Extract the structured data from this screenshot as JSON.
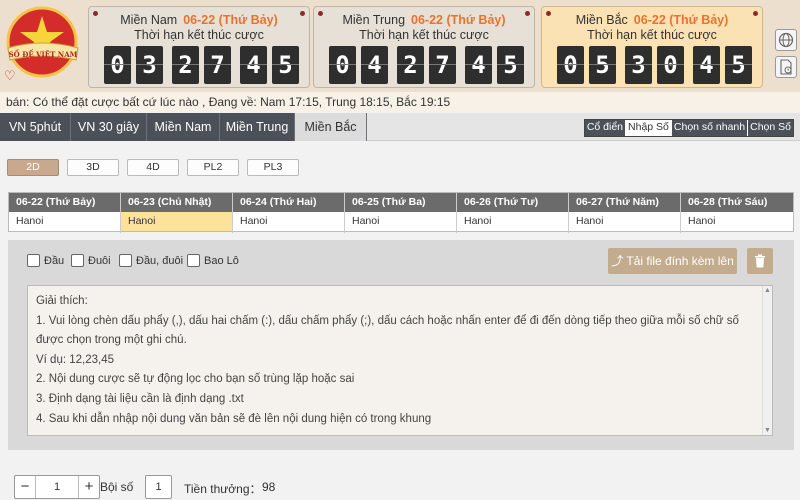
{
  "logo": {
    "text": "SỐ ĐỀ VIỆT NAM"
  },
  "regions": [
    {
      "name": "Miền Nam",
      "date": "06-22 (Thứ Bảy)",
      "subtitle": "Thời hạn kết thúc cược",
      "digits": [
        "0",
        "3",
        "2",
        "7",
        "4",
        "5"
      ],
      "active": false
    },
    {
      "name": "Miền Trung",
      "date": "06-22 (Thứ Bảy)",
      "subtitle": "Thời hạn kết thúc cược",
      "digits": [
        "0",
        "4",
        "2",
        "7",
        "4",
        "5"
      ],
      "active": false
    },
    {
      "name": "Miền Bắc",
      "date": "06-22 (Thứ Bảy)",
      "subtitle": "Thời hạn kết thúc cược",
      "digits": [
        "0",
        "5",
        "3",
        "0",
        "4",
        "5"
      ],
      "active": true
    }
  ],
  "side_icons": [
    "globe-icon",
    "document-clock-icon"
  ],
  "notice": "bán: Có thể đặt cược bất cứ lúc nào ,   Đang về: Nam 17:15, Trung 18:15, Bắc 19:15",
  "nav": {
    "tabs": [
      "VN 5phút",
      "VN 30 giây",
      "Miền Nam",
      "Miền Trung",
      "Miền Bắc"
    ],
    "active_tab": "Miền Bắc",
    "modes": [
      "Cổ điển",
      "Nhập Số",
      "Chọn số nhanh",
      "Chọn Số"
    ],
    "active_mode": "Nhập Số"
  },
  "game_types": [
    "2D",
    "3D",
    "4D",
    "PL2",
    "PL3"
  ],
  "active_game_type": "2D",
  "dates": [
    {
      "date": "06-22 (Thứ Bảy)",
      "place": "Hanoi"
    },
    {
      "date": "06-23 (Chủ Nhật)",
      "place": "Hanoi"
    },
    {
      "date": "06-24 (Thứ Hai)",
      "place": "Hanoi"
    },
    {
      "date": "06-25 (Thứ Ba)",
      "place": "Hanoi"
    },
    {
      "date": "06-26 (Thứ Tư)",
      "place": "Hanoi"
    },
    {
      "date": "06-27 (Thứ Năm)",
      "place": "Hanoi"
    },
    {
      "date": "06-28 (Thứ Sáu)",
      "place": "Hanoi"
    }
  ],
  "active_date_index": 1,
  "checkboxes": [
    "Đầu",
    "Đuôi",
    "Đầu, đuôi",
    "Bao Lô"
  ],
  "upload_label": "Tải file đính kèm lên",
  "explanation": {
    "title": "Giải thích:",
    "lines": [
      "1. Vui lòng chèn dấu phẩy (,), dấu hai chấm (:), dấu chấm phẩy (;), dấu cách hoặc nhấn enter để đi đến dòng tiếp theo giữa mỗi số chữ số",
      "được chọn trong một ghi chú.",
      "Ví dụ: 12,23,45",
      "2. Nội dung cược sẽ tự động lọc cho bạn số trùng lặp hoặc sai",
      "3. Định dạng tài liệu cần là định dạng .txt",
      "4. Sau khi dẫn nhập nội dung văn bản sẽ đè lên nội dung hiện có trong khung"
    ]
  },
  "bottom": {
    "stepper_value": "1",
    "multiplier_label": "Bội số",
    "multiplier_value": "1",
    "prize_label": "Tiền thưởng：",
    "prize_value": "98"
  },
  "colors": {
    "accent": "#e8742c",
    "button": "#c3ab8e",
    "active_cell": "#fde29a",
    "nav_dark": "#4c5058"
  }
}
